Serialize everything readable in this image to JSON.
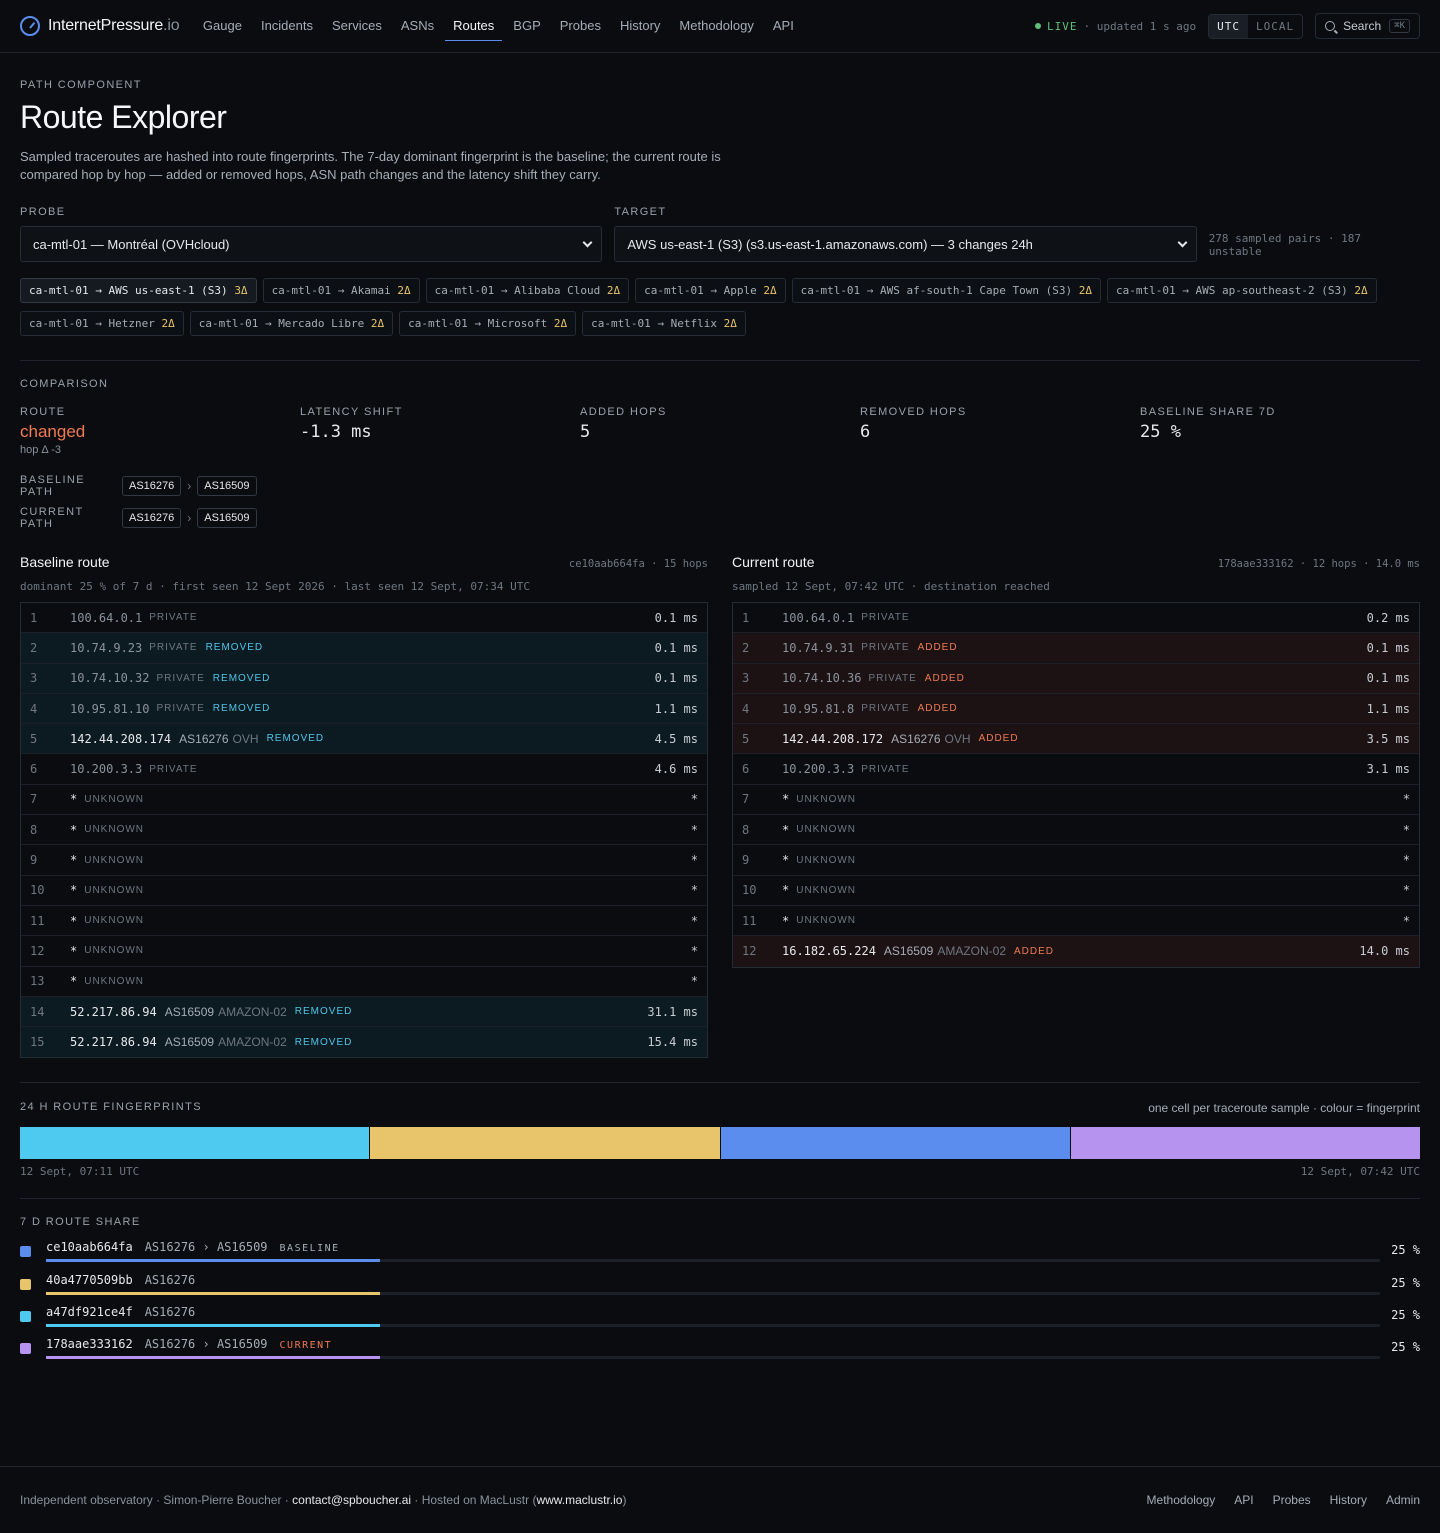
{
  "brand": {
    "name": "InternetPressure",
    "tld": ".io"
  },
  "nav": [
    {
      "label": "Gauge",
      "active": false
    },
    {
      "label": "Incidents",
      "active": false
    },
    {
      "label": "Services",
      "active": false
    },
    {
      "label": "ASNs",
      "active": false
    },
    {
      "label": "Routes",
      "active": true
    },
    {
      "label": "BGP",
      "active": false
    },
    {
      "label": "Probes",
      "active": false
    },
    {
      "label": "History",
      "active": false
    },
    {
      "label": "Methodology",
      "active": false
    },
    {
      "label": "API",
      "active": false
    }
  ],
  "status": {
    "live": "LIVE",
    "updated": "· updated 1 s ago",
    "tz_utc": "UTC",
    "tz_local": "LOCAL",
    "search": "Search",
    "search_kbd": "⌘K"
  },
  "page": {
    "eyebrow": "PATH COMPONENT",
    "title": "Route Explorer",
    "lede": "Sampled traceroutes are hashed into route fingerprints. The 7-day dominant fingerprint is the baseline; the current route is compared hop by hop — added or removed hops, ASN path changes and the latency shift they carry."
  },
  "selectors": {
    "probe_label": "PROBE",
    "probe_value": "ca-mtl-01 — Montréal (OVHcloud)",
    "target_label": "TARGET",
    "target_value": "AWS us-east-1 (S3) (s3.us-east-1.amazonaws.com) — 3 changes 24h",
    "pairs_info": "278 sampled pairs · 187 unstable"
  },
  "chips": [
    {
      "label": "ca-mtl-01 → AWS us-east-1 (S3)",
      "delta": "3Δ",
      "active": true
    },
    {
      "label": "ca-mtl-01 → Akamai",
      "delta": "2Δ",
      "active": false
    },
    {
      "label": "ca-mtl-01 → Alibaba Cloud",
      "delta": "2Δ",
      "active": false
    },
    {
      "label": "ca-mtl-01 → Apple",
      "delta": "2Δ",
      "active": false
    },
    {
      "label": "ca-mtl-01 → AWS af-south-1 Cape Town (S3)",
      "delta": "2Δ",
      "active": false
    },
    {
      "label": "ca-mtl-01 → AWS ap-southeast-2 (S3)",
      "delta": "2Δ",
      "active": false
    },
    {
      "label": "ca-mtl-01 → Hetzner",
      "delta": "2Δ",
      "active": false
    },
    {
      "label": "ca-mtl-01 → Mercado Libre",
      "delta": "2Δ",
      "active": false
    },
    {
      "label": "ca-mtl-01 → Microsoft",
      "delta": "2Δ",
      "active": false
    },
    {
      "label": "ca-mtl-01 → Netflix",
      "delta": "2Δ",
      "active": false
    }
  ],
  "comparison": {
    "eyebrow": "COMPARISON",
    "stats": [
      {
        "label": "ROUTE",
        "value": "changed",
        "sub": "hop Δ -3",
        "kind": "changed"
      },
      {
        "label": "LATENCY SHIFT",
        "value": "-1.3 ms",
        "sub": "",
        "kind": "mono"
      },
      {
        "label": "ADDED HOPS",
        "value": "5",
        "sub": "",
        "kind": "mono"
      },
      {
        "label": "REMOVED HOPS",
        "value": "6",
        "sub": "",
        "kind": "mono"
      },
      {
        "label": "BASELINE SHARE 7D",
        "value": "25 %",
        "sub": "",
        "kind": "mono"
      }
    ],
    "baseline_path_label": "BASELINE PATH",
    "baseline_path": [
      "AS16276",
      "AS16509"
    ],
    "current_path_label": "CURRENT PATH",
    "current_path": [
      "AS16276",
      "AS16509"
    ]
  },
  "baseline": {
    "title": "Baseline route",
    "meta": "ce10aab664fa · 15 hops",
    "sub": "dominant 25 % of 7 d · first seen 12 Sept 2026 · last seen 12 Sept, 07:34 UTC",
    "hops": [
      {
        "n": "1",
        "ip": "100.64.0.1",
        "cls": "PRIVATE",
        "asn": "",
        "org": "",
        "tag": "",
        "ms": "0.1 ms",
        "pub": false
      },
      {
        "n": "2",
        "ip": "10.74.9.23",
        "cls": "PRIVATE",
        "asn": "",
        "org": "",
        "tag": "REMOVED",
        "ms": "0.1 ms",
        "pub": false
      },
      {
        "n": "3",
        "ip": "10.74.10.32",
        "cls": "PRIVATE",
        "asn": "",
        "org": "",
        "tag": "REMOVED",
        "ms": "0.1 ms",
        "pub": false
      },
      {
        "n": "4",
        "ip": "10.95.81.10",
        "cls": "PRIVATE",
        "asn": "",
        "org": "",
        "tag": "REMOVED",
        "ms": "1.1 ms",
        "pub": false
      },
      {
        "n": "5",
        "ip": "142.44.208.174",
        "cls": "",
        "asn": "AS16276",
        "org": "OVH",
        "tag": "REMOVED",
        "ms": "4.5 ms",
        "pub": true
      },
      {
        "n": "6",
        "ip": "10.200.3.3",
        "cls": "PRIVATE",
        "asn": "",
        "org": "",
        "tag": "",
        "ms": "4.6 ms",
        "pub": false
      },
      {
        "n": "7",
        "ip": "*",
        "cls": "UNKNOWN",
        "asn": "",
        "org": "",
        "tag": "",
        "ms": "*",
        "pub": true
      },
      {
        "n": "8",
        "ip": "*",
        "cls": "UNKNOWN",
        "asn": "",
        "org": "",
        "tag": "",
        "ms": "*",
        "pub": true
      },
      {
        "n": "9",
        "ip": "*",
        "cls": "UNKNOWN",
        "asn": "",
        "org": "",
        "tag": "",
        "ms": "*",
        "pub": true
      },
      {
        "n": "10",
        "ip": "*",
        "cls": "UNKNOWN",
        "asn": "",
        "org": "",
        "tag": "",
        "ms": "*",
        "pub": true
      },
      {
        "n": "11",
        "ip": "*",
        "cls": "UNKNOWN",
        "asn": "",
        "org": "",
        "tag": "",
        "ms": "*",
        "pub": true
      },
      {
        "n": "12",
        "ip": "*",
        "cls": "UNKNOWN",
        "asn": "",
        "org": "",
        "tag": "",
        "ms": "*",
        "pub": true
      },
      {
        "n": "13",
        "ip": "*",
        "cls": "UNKNOWN",
        "asn": "",
        "org": "",
        "tag": "",
        "ms": "*",
        "pub": true
      },
      {
        "n": "14",
        "ip": "52.217.86.94",
        "cls": "",
        "asn": "AS16509",
        "org": "AMAZON-02",
        "tag": "REMOVED",
        "ms": "31.1 ms",
        "pub": true
      },
      {
        "n": "15",
        "ip": "52.217.86.94",
        "cls": "",
        "asn": "AS16509",
        "org": "AMAZON-02",
        "tag": "REMOVED",
        "ms": "15.4 ms",
        "pub": true
      }
    ]
  },
  "current": {
    "title": "Current route",
    "meta": "178aae333162 · 12 hops · 14.0 ms",
    "sub": "sampled 12 Sept, 07:42 UTC · destination reached",
    "hops": [
      {
        "n": "1",
        "ip": "100.64.0.1",
        "cls": "PRIVATE",
        "asn": "",
        "org": "",
        "tag": "",
        "ms": "0.2 ms",
        "pub": false
      },
      {
        "n": "2",
        "ip": "10.74.9.31",
        "cls": "PRIVATE",
        "asn": "",
        "org": "",
        "tag": "ADDED",
        "ms": "0.1 ms",
        "pub": false
      },
      {
        "n": "3",
        "ip": "10.74.10.36",
        "cls": "PRIVATE",
        "asn": "",
        "org": "",
        "tag": "ADDED",
        "ms": "0.1 ms",
        "pub": false
      },
      {
        "n": "4",
        "ip": "10.95.81.8",
        "cls": "PRIVATE",
        "asn": "",
        "org": "",
        "tag": "ADDED",
        "ms": "1.1 ms",
        "pub": false
      },
      {
        "n": "5",
        "ip": "142.44.208.172",
        "cls": "",
        "asn": "AS16276",
        "org": "OVH",
        "tag": "ADDED",
        "ms": "3.5 ms",
        "pub": true
      },
      {
        "n": "6",
        "ip": "10.200.3.3",
        "cls": "PRIVATE",
        "asn": "",
        "org": "",
        "tag": "",
        "ms": "3.1 ms",
        "pub": false
      },
      {
        "n": "7",
        "ip": "*",
        "cls": "UNKNOWN",
        "asn": "",
        "org": "",
        "tag": "",
        "ms": "*",
        "pub": true
      },
      {
        "n": "8",
        "ip": "*",
        "cls": "UNKNOWN",
        "asn": "",
        "org": "",
        "tag": "",
        "ms": "*",
        "pub": true
      },
      {
        "n": "9",
        "ip": "*",
        "cls": "UNKNOWN",
        "asn": "",
        "org": "",
        "tag": "",
        "ms": "*",
        "pub": true
      },
      {
        "n": "10",
        "ip": "*",
        "cls": "UNKNOWN",
        "asn": "",
        "org": "",
        "tag": "",
        "ms": "*",
        "pub": true
      },
      {
        "n": "11",
        "ip": "*",
        "cls": "UNKNOWN",
        "asn": "",
        "org": "",
        "tag": "",
        "ms": "*",
        "pub": true
      },
      {
        "n": "12",
        "ip": "16.182.65.224",
        "cls": "",
        "asn": "AS16509",
        "org": "AMAZON-02",
        "tag": "ADDED",
        "ms": "14.0 ms",
        "pub": true
      }
    ]
  },
  "fingerprints": {
    "eyebrow": "24 H ROUTE FINGERPRINTS",
    "note": "one cell per traceroute sample · colour = fingerprint",
    "cells": [
      "#4ec9ef",
      "#e8c46a",
      "#5b8def",
      "#b693ef"
    ],
    "start": "12 Sept, 07:11 UTC",
    "end": "12 Sept, 07:42 UTC"
  },
  "share": {
    "eyebrow": "7 D ROUTE SHARE",
    "rows": [
      {
        "fp": "ce10aab664fa",
        "path": "AS16276 › AS16509",
        "badge": "BASELINE",
        "badge_kind": "base",
        "pct": "25 %",
        "share": 0.25,
        "color": "#5b8def"
      },
      {
        "fp": "40a4770509bb",
        "path": "AS16276",
        "badge": "",
        "badge_kind": "",
        "pct": "25 %",
        "share": 0.25,
        "color": "#e8c46a"
      },
      {
        "fp": "a47df921ce4f",
        "path": "AS16276",
        "badge": "",
        "badge_kind": "",
        "pct": "25 %",
        "share": 0.25,
        "color": "#4ec9ef"
      },
      {
        "fp": "178aae333162",
        "path": "AS16276 › AS16509",
        "badge": "CURRENT",
        "badge_kind": "cur",
        "pct": "25 %",
        "share": 0.25,
        "color": "#b693ef"
      }
    ]
  },
  "footer": {
    "prefix": "Independent observatory · Simon-Pierre Boucher · ",
    "email": "contact@spboucher.ai",
    "middle": " · Hosted on MacLustr (",
    "host": "www.maclustr.io",
    "suffix": ")",
    "links": [
      "Methodology",
      "API",
      "Probes",
      "History",
      "Admin"
    ]
  }
}
